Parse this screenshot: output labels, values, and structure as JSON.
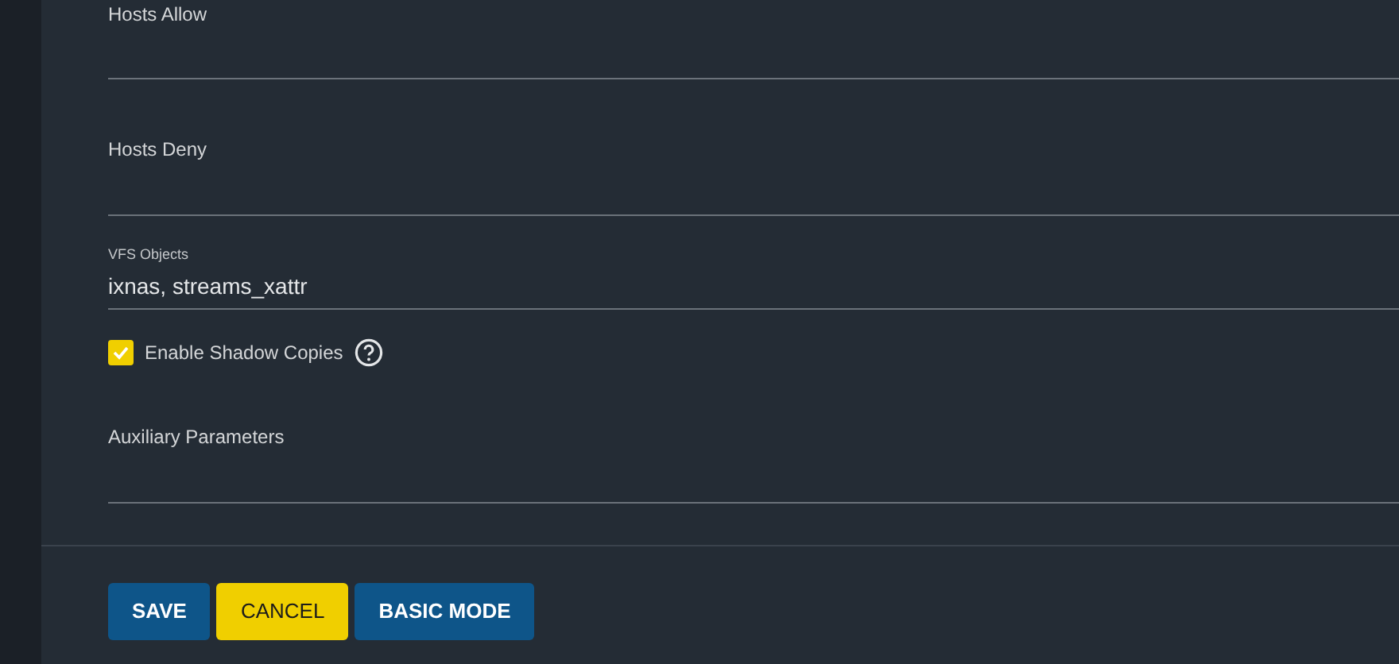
{
  "fields": [
    {
      "kind": "text",
      "label": "Hosts Allow"
    },
    {
      "kind": "text",
      "label": "Hosts Deny"
    },
    {
      "kind": "text",
      "label": "VFS Objects",
      "value": "ixnas, streams_xattr"
    },
    {
      "kind": "checkbox",
      "label": "Enable Shadow Copies",
      "checked": true,
      "help": true
    },
    {
      "kind": "text",
      "label": "Auxiliary Parameters"
    }
  ],
  "buttons": [
    {
      "label": "SAVE",
      "kind": "primary"
    },
    {
      "label": "CANCEL",
      "kind": "warning"
    },
    {
      "label": "BASIC MODE",
      "kind": "primary"
    }
  ]
}
